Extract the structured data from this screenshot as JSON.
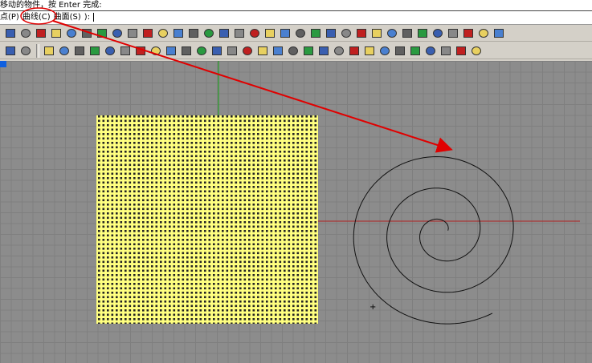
{
  "command": {
    "prompt": "移动的物件，按 Enter 完成:",
    "options": [
      "点(P)",
      "曲线(C)",
      "曲面(S)"
    ],
    "suffix": "):"
  },
  "toolbar1": [
    "printer-icon",
    "new-file-icon",
    "cut-icon",
    "copy-icon",
    "paste-icon",
    "undo-icon",
    "pan-hand-icon",
    "rotate-view-icon",
    "zoom-icon",
    "zoom-window-icon",
    "zoom-extents-icon",
    "zoom-selected-icon",
    "undo-view-icon",
    "four-viewports-icon",
    "car-icon",
    "grid-plane-icon",
    "circle-icon",
    "spiral-icon",
    "lightbulb-icon",
    "spotlight-icon",
    "bulb-icon",
    "light-icon",
    "material-icon",
    "color-wheel-icon",
    "render-icon",
    "sphere-icon",
    "arrow-icon",
    "puzzle-icon",
    "curve-icon",
    "point-curve-icon",
    "help-icon",
    "link-icon",
    "sphere-blue-icon"
  ],
  "toolbar2": [
    "layers-icon",
    "delete-icon",
    "|",
    "move-point-icon",
    "scale-icon",
    "array-icon",
    "edit-icon",
    "box-icon",
    "mirror-icon",
    "diamond-icon",
    "project-icon",
    "points-icon",
    "flow-icon",
    "align-icon",
    "grid-points-icon",
    "circle-points-icon",
    "z-icon",
    "orient-icon",
    "bend-icon",
    "taper-icon",
    "twist-icon",
    "shear-icon",
    "stretch-icon",
    "wave-icon",
    "cage-icon",
    "mesh-icon",
    "cube-icon",
    "box-blue-icon",
    "panel-icon",
    "render-preview-icon",
    "camera-icon",
    "split-icon"
  ],
  "colors": {
    "viewport": "#8c8c8c",
    "surface": "#ffff80",
    "x_axis": "#b02020",
    "y_axis": "#10a010",
    "annotation": "#e00000"
  }
}
